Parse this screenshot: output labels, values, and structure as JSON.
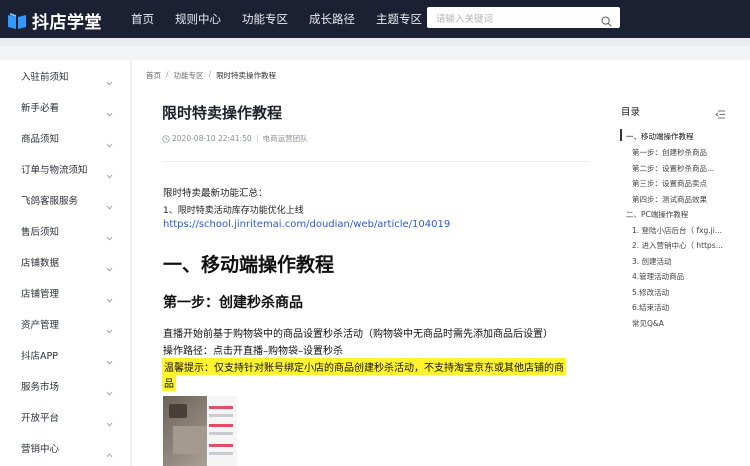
{
  "header": {
    "logo_text": "抖店学堂",
    "nav": [
      "首页",
      "规则中心",
      "功能专区",
      "成长路径",
      "主题专区"
    ],
    "search_placeholder": "请输入关键词"
  },
  "sidebar": {
    "items": [
      {
        "label": "入驻前须知",
        "chevron": "down"
      },
      {
        "label": "新手必看",
        "chevron": "down"
      },
      {
        "label": "商品须知",
        "chevron": "down"
      },
      {
        "label": "订单与物流须知",
        "chevron": "down"
      },
      {
        "label": "飞鸽客服服务",
        "chevron": "down"
      },
      {
        "label": "售后须知",
        "chevron": "down"
      },
      {
        "label": "店铺数据",
        "chevron": "down"
      },
      {
        "label": "店铺管理",
        "chevron": "down"
      },
      {
        "label": "资产管理",
        "chevron": "down"
      },
      {
        "label": "抖店APP",
        "chevron": "down"
      },
      {
        "label": "服务市场",
        "chevron": "down"
      },
      {
        "label": "开放平台",
        "chevron": "down"
      },
      {
        "label": "营销中心",
        "chevron": "up"
      }
    ]
  },
  "breadcrumb": [
    "首页",
    "功能专区",
    "限时特卖操作教程"
  ],
  "article": {
    "title": "限时特卖操作教程",
    "datetime": "2020-08-10 22:41:50",
    "author": "电商运营团队",
    "intro_line1": "限时特卖最新功能汇总：",
    "intro_line2": "1、限时特卖活动库存功能优化上线",
    "intro_link": "https://school.jinritemai.com/doudian/web/article/104019",
    "h1": "一、移动端操作教程",
    "h2": "第一步：创建秒杀商品",
    "p1": "直播开始前基于购物袋中的商品设置秒杀活动（购物袋中无商品时需先添加商品后设置）",
    "p2": "操作路径：点击开直播–购物袋–设置秒杀",
    "tip_line1": "温馨提示：仅支持针对账号绑定小店的商品创建秒杀活动，不支持淘宝京东或其他店铺的商",
    "tip_line2": "品"
  },
  "toc": {
    "title": "目录",
    "items": [
      {
        "label": "一、移动端操作教程",
        "level": 1
      },
      {
        "label": "第一步：创建秒杀商品",
        "level": 2
      },
      {
        "label": "第二步：设置秒杀商品...",
        "level": 2
      },
      {
        "label": "第三步：设置商品卖点",
        "level": 2
      },
      {
        "label": "第四步：测试商品效果",
        "level": 2
      },
      {
        "label": "二、PC端操作教程",
        "level": 1
      },
      {
        "label": "1. 登陆小店后台（ fxg.ji...",
        "level": 2
      },
      {
        "label": "2. 进入营销中心（ https...",
        "level": 2
      },
      {
        "label": "3. 创建活动",
        "level": 2
      },
      {
        "label": "4.管理活动商品",
        "level": 2
      },
      {
        "label": "5.修改活动",
        "level": 2
      },
      {
        "label": "6.结束活动",
        "level": 2
      },
      {
        "label": "常见Q&A",
        "level": 2
      }
    ]
  },
  "colors": {
    "header_bg": "#1b2132",
    "link": "#2d5bd4",
    "highlight": "#fff22e",
    "logo_accent": "#2f9bff"
  }
}
